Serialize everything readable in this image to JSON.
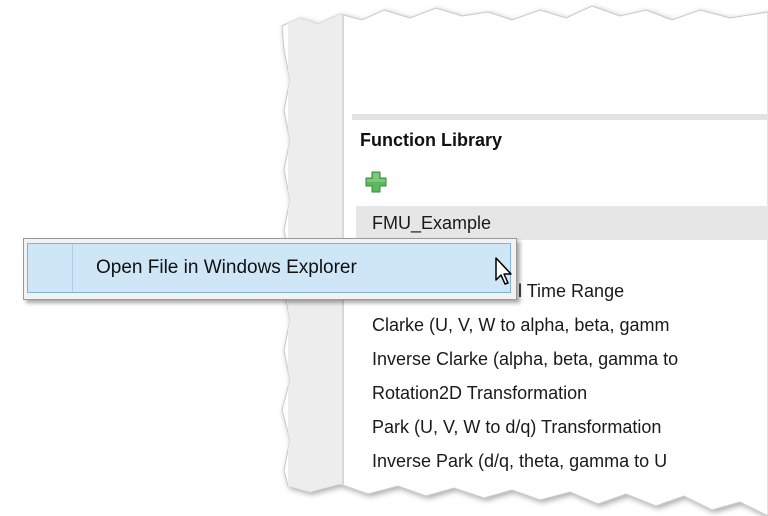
{
  "colors": {
    "selected_row": "#e6e6e6",
    "menu_highlight": "#cfe6f7",
    "add_icon": "#5cb85c"
  },
  "library": {
    "title": "Function Library",
    "add_icon": "plus-icon",
    "items": [
      {
        "label": "FMU_Example",
        "selected": true
      },
      {
        "label": "Min/Max of Overall Time Range"
      },
      {
        "label": "Clarke (U, V, W to alpha, beta, gamm"
      },
      {
        "label": "Inverse Clarke (alpha, beta, gamma to"
      },
      {
        "label": "Rotation2D Transformation"
      },
      {
        "label": "Park (U, V, W to d/q) Transformation"
      },
      {
        "label": "Inverse Park (d/q, theta, gamma to U"
      }
    ]
  },
  "context_menu": {
    "items": [
      {
        "label": "Open File in Windows Explorer"
      }
    ]
  }
}
